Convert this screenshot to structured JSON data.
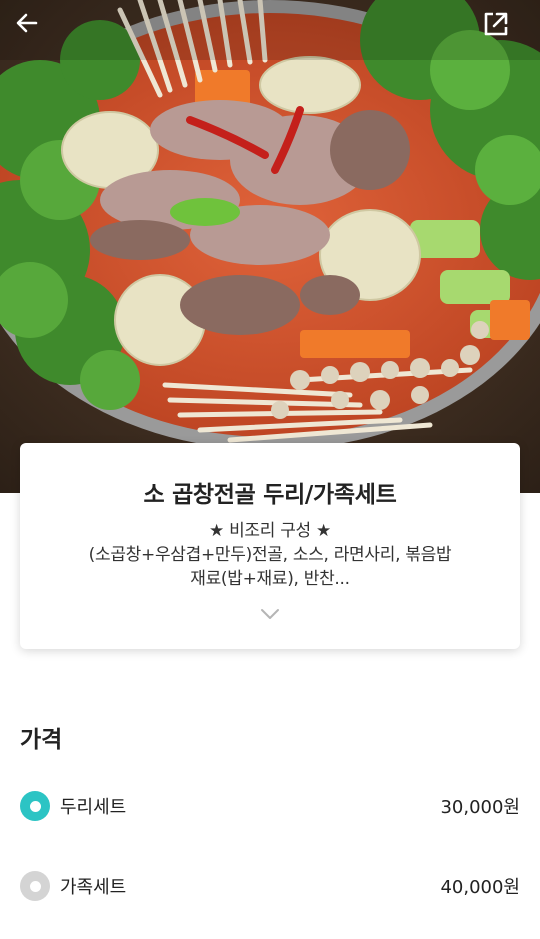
{
  "header": {
    "back_icon": "arrow-left-icon",
    "share_icon": "share-external-icon"
  },
  "product": {
    "title": "소 곱창전골 두리/가족세트",
    "desc_line1": "★ 비조리 구성 ★",
    "desc_line2": "(소곱창+우삼겹+만두)전골, 소스, 라면사리, 볶음밥",
    "desc_line3": "재료(밥+재료), 반찬...",
    "expand_icon": "chevron-down-icon"
  },
  "price_section": {
    "heading": "가격",
    "options": [
      {
        "label": "두리세트",
        "price": "30,000원",
        "selected": true
      },
      {
        "label": "가족세트",
        "price": "40,000원",
        "selected": false
      }
    ]
  },
  "colors": {
    "accent": "#2cc4c4",
    "radio_unselected": "#d4d4d4"
  }
}
